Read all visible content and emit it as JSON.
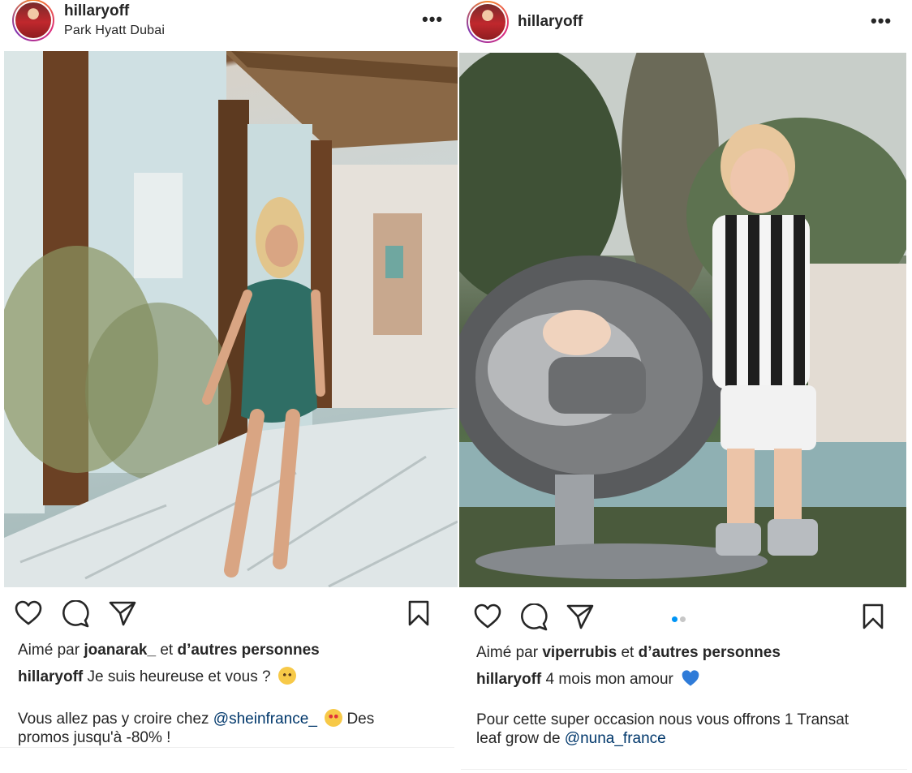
{
  "left_post": {
    "username": "hillaryoff",
    "location": "Park Hyatt Dubai",
    "more_label": "•••",
    "liked_prefix": "Aimé par",
    "liked_user": "joanarak_",
    "liked_and": "et",
    "liked_others": "d’autres personnes",
    "caption_user": "hillaryoff",
    "caption_text": "Je suis heureuse et vous ?",
    "caption_emoji": "pleading-face-emoji",
    "body_line1_prefix": "Vous allez pas y croire chez",
    "body_mention": "@sheinfrance_",
    "body_emoji": "star-struck-emoji",
    "body_line1_suffix": "Des",
    "body_line2": "promos jusqu'à -80% !"
  },
  "right_post": {
    "username": "hillaryoff",
    "more_label": "•••",
    "carousel_dots": 2,
    "carousel_active": 1,
    "liked_prefix": "Aimé par",
    "liked_user": "viperrubis",
    "liked_and": "et",
    "liked_others": "d’autres personnes",
    "caption_user": "hillaryoff",
    "caption_text": "4 mois mon amour",
    "caption_emoji": "blue-heart-emoji",
    "body_line1": "Pour cette super occasion nous vous offrons 1 Transat",
    "body_line2_prefix": "leaf grow de",
    "body_mention": "@nuna_france"
  },
  "icons": [
    "heart-icon",
    "comment-icon",
    "share-icon",
    "bookmark-icon"
  ],
  "colors": {
    "text": "#262626",
    "mention": "#00376b",
    "dot_active": "#0095f6",
    "dot_inactive": "#c7c7c7"
  }
}
